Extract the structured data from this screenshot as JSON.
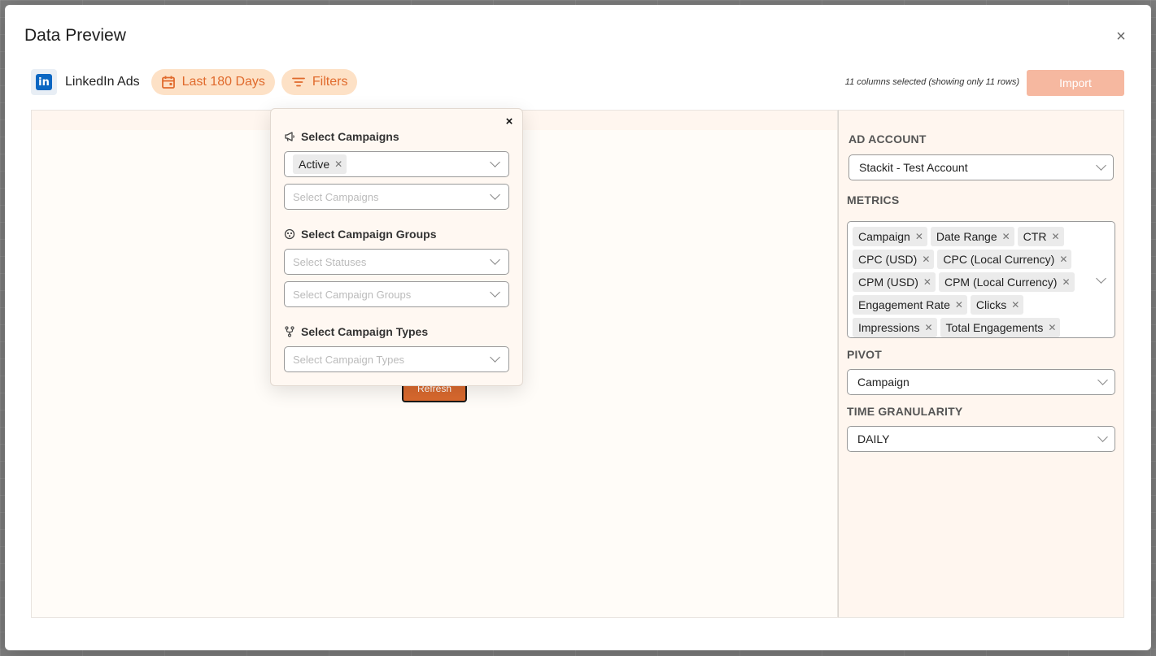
{
  "modal": {
    "title": "Data Preview",
    "close_icon": "×"
  },
  "toolbar": {
    "source_name": "LinkedIn Ads",
    "source_logo_text": "in",
    "date_range_label": "Last 180 Days",
    "filters_label": "Filters",
    "selected_info": "11 columns selected (showing only 11 rows)",
    "import_label": "Import"
  },
  "preview": {
    "refresh_label": "Refresh"
  },
  "filters_popover": {
    "close_icon": "×",
    "campaigns": {
      "title": "Select Campaigns",
      "status_tag": "Active",
      "campaigns_placeholder": "Select Campaigns"
    },
    "campaign_groups": {
      "title": "Select Campaign Groups",
      "statuses_placeholder": "Select Statuses",
      "groups_placeholder": "Select Campaign Groups"
    },
    "campaign_types": {
      "title": "Select Campaign Types",
      "types_placeholder": "Select Campaign Types"
    }
  },
  "side_panel": {
    "ad_account": {
      "label": "AD ACCOUNT",
      "value": "Stackit - Test Account"
    },
    "metrics": {
      "label": "METRICS",
      "tags": [
        "Campaign",
        "Date Range",
        "CTR",
        "CPC (USD)",
        "CPC (Local Currency)",
        "CPM (USD)",
        "CPM (Local Currency)",
        "Engagement Rate",
        "Clicks",
        "Impressions",
        "Total Engagements"
      ]
    },
    "pivot": {
      "label": "PIVOT",
      "value": "Campaign"
    },
    "time_granularity": {
      "label": "TIME GRANULARITY",
      "value": "DAILY"
    }
  },
  "colors": {
    "accent": "#e06a2c",
    "pill_bg": "#fde1c6",
    "refresh_bg": "#d9692e",
    "import_bg": "#f6b8a0",
    "linkedin_blue": "#0a66c2"
  },
  "icons": {
    "date_pill": "calendar-icon",
    "filters_pill": "filter-icon",
    "campaigns_section": "megaphone-icon",
    "groups_section": "group-icon",
    "types_section": "branch-icon"
  }
}
